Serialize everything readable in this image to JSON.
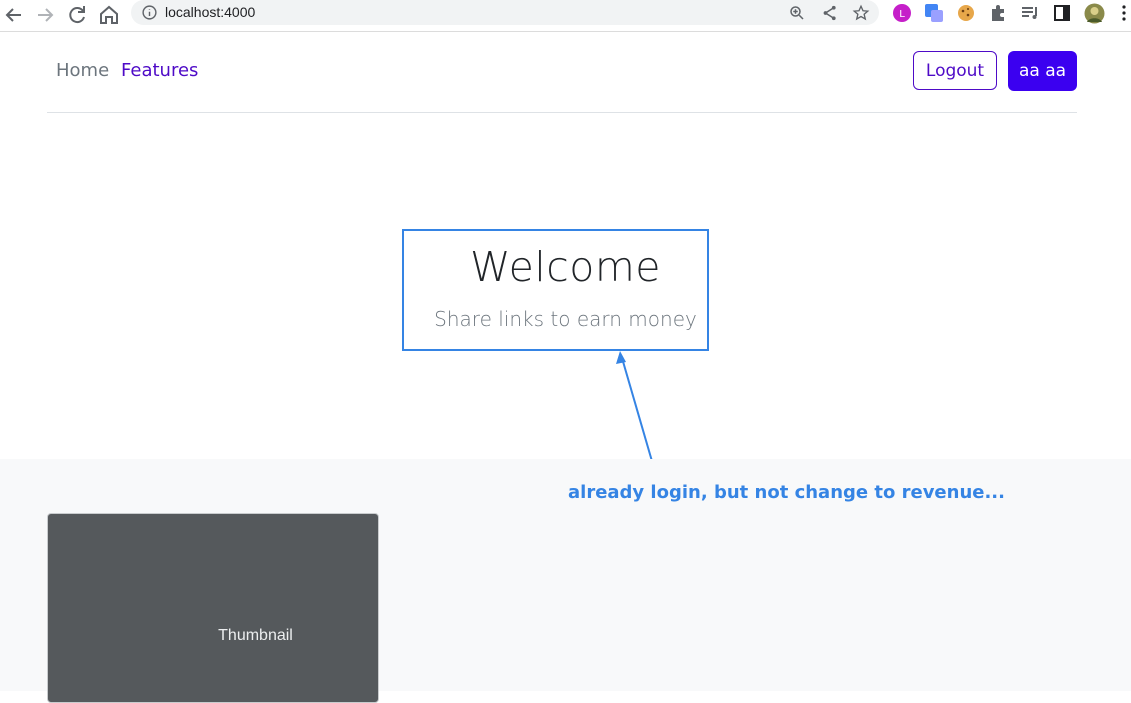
{
  "browser": {
    "url": "localhost:4000"
  },
  "nav": {
    "home": "Home",
    "features": "Features",
    "logout": "Logout",
    "user": "aa aa"
  },
  "hero": {
    "title": "Welcome",
    "subtitle": "Share links to earn money"
  },
  "annotation": {
    "text": "already login, but not change to revenue..."
  },
  "card": {
    "thumbnail_label": "Thumbnail"
  },
  "colors": {
    "brand": "#4e0ac7",
    "user_button": "#3b00f0",
    "annotation": "#3584e4"
  }
}
